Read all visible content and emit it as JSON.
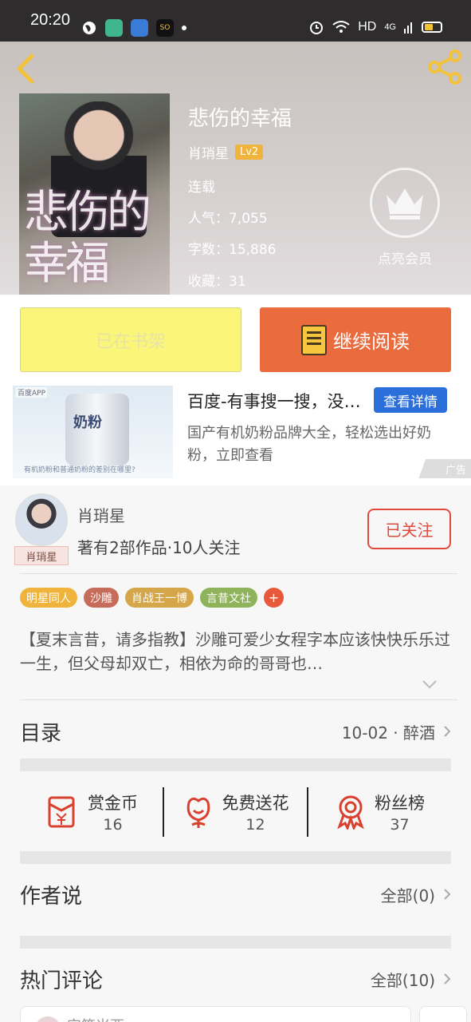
{
  "status_bar": {
    "time": "20:20",
    "network": "HD",
    "signal": "4G"
  },
  "header": {
    "back_icon": "chevron-left-icon",
    "share_icon": "share-icon"
  },
  "book": {
    "title": "悲伤的幸福",
    "cover_title": "悲伤的幸福",
    "author": "肖琑星",
    "level": "Lv2",
    "status": "连载",
    "popularity": "人气：7,055",
    "word_count": "字数：15,886",
    "favorites": "收藏：31"
  },
  "vip": {
    "label": "点亮会员",
    "icon": "crown-icon"
  },
  "actions": {
    "shelf_label": "已在书架",
    "read_label": "继续阅读"
  },
  "ad": {
    "title": "百度-有事搜一搜，没事看一看",
    "cta": "查看详情",
    "description": "国产有机奶粉品牌大全，轻松选出好奶粉，立即查看",
    "label": "广告",
    "image_tag": "百度APP",
    "image_text": "奶粉",
    "image_caption": "有机奶粉和普通奶粉的差别在哪里?"
  },
  "author": {
    "name": "肖琑星",
    "avatar_name": "肖琑星",
    "works": "著有2部作品·10人关注",
    "follow_label": "已关注"
  },
  "tags": [
    {
      "label": "明星同人",
      "color": "#f0b43c"
    },
    {
      "label": "沙雕",
      "color": "#c76b5a"
    },
    {
      "label": "肖战王一博",
      "color": "#d6a64a"
    },
    {
      "label": "言昔文社",
      "color": "#8fb35a"
    }
  ],
  "synopsis": "【夏末言昔，请多指教】沙雕可爱少女程字本应该快快乐乐过一生，但父母却双亡，相依为命的哥哥也…",
  "catalog": {
    "label": "目录",
    "latest": "10-02 · 醉酒"
  },
  "stats": [
    {
      "label": "赏金币",
      "value": "16",
      "icon": "red-envelope-icon"
    },
    {
      "label": "免费送花",
      "value": "12",
      "icon": "flower-icon"
    },
    {
      "label": "粉丝榜",
      "value": "37",
      "icon": "medal-icon"
    }
  ],
  "author_says": {
    "label": "作者说",
    "all": "全部(0)"
  },
  "hot_comments": {
    "label": "热门评论",
    "all": "全部(10)",
    "first_user": "安笙米酉"
  }
}
